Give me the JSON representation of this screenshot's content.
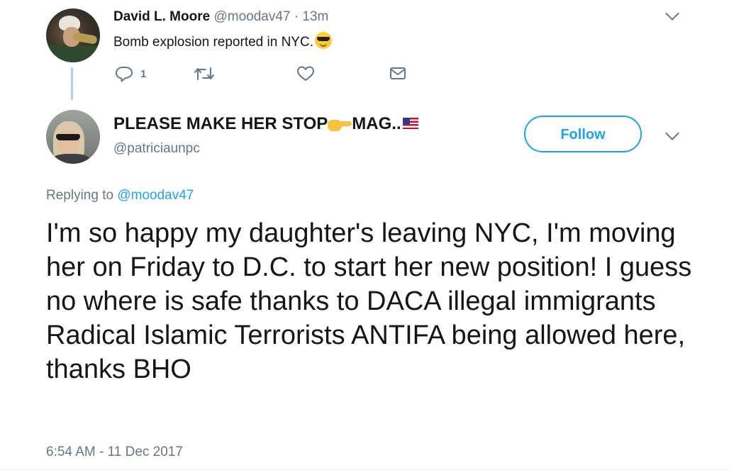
{
  "parent_tweet": {
    "author_name": "David L. Moore",
    "handle": "@moodav47",
    "separator": "·",
    "time_ago": "13m",
    "text": "Bomb explosion reported in NYC.",
    "emoji": "smiling-face-with-sunglasses",
    "reply_count": "1"
  },
  "main_tweet": {
    "author_name": "PLEASE MAKE HER STOP",
    "author_name_suffix": "MAG..",
    "name_emojis": [
      "backhand-index-pointing-right",
      "flag-united-states"
    ],
    "handle": "@patriciaunpc",
    "follow_label": "Follow",
    "replying_prefix": "Replying to",
    "replying_to": "@moodav47",
    "text": "I'm so happy my daughter's leaving NYC, I'm moving her on Friday to D.C. to start her new position! I guess no where is safe thanks to DACA illegal immigrants Radical Islamic Terrorists ANTIFA being allowed here, thanks BHO",
    "timestamp": "6:54 AM - 11 Dec 2017"
  },
  "icons": {
    "reply": "reply-icon",
    "retweet": "retweet-icon",
    "like": "heart-icon",
    "dm": "envelope-icon",
    "more": "chevron-down-icon"
  },
  "colors": {
    "accent": "#1da1f2",
    "secondary_text": "#657786",
    "primary_text": "#14171a",
    "thread_line": "#a7d4f2"
  }
}
